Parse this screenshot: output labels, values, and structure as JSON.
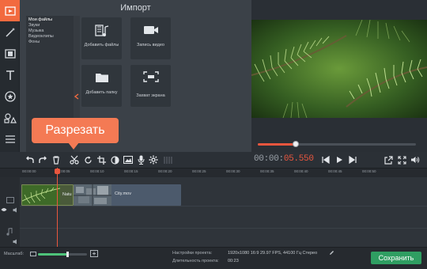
{
  "import": {
    "title": "Импорт",
    "categories": [
      "Мои файлы",
      "Звуки",
      "Музыка",
      "Видеоклипы",
      "Фоны"
    ],
    "buttons": [
      {
        "label": "Добавить файлы",
        "icon": "film-music-icon"
      },
      {
        "label": "Запись видео",
        "icon": "camera-icon"
      },
      {
        "label": "Добавить папку",
        "icon": "folder-icon"
      },
      {
        "label": "Захват экрана",
        "icon": "screen-capture-icon"
      }
    ]
  },
  "tooltip": {
    "text": "Разрезать"
  },
  "player": {
    "timecode_main": "00:00:",
    "timecode_accent": "05.550",
    "progress": 0.24
  },
  "timeline": {
    "ticks": [
      "00:00:00",
      "00:00:05",
      "00:00:10",
      "00:00:15",
      "00:00:20",
      "00:00:25",
      "00:00:30",
      "00:00:35",
      "00:00:40",
      "00:00:45",
      "00:00:50"
    ],
    "clips": [
      {
        "name": "Natu"
      },
      {
        "name": "City.mov"
      }
    ]
  },
  "status": {
    "zoom_label": "Масштаб:",
    "zoom_level": 0.6,
    "settings_label": "Настройки проекта:",
    "settings_value": "1920x1080 16:9 29.97 FPS, 44100 Гц Стерео",
    "duration_label": "Длительность проекта:",
    "duration_value": "00:23",
    "save_label": "Сохранить"
  },
  "colors": {
    "accent": "#f26a3f",
    "save": "#2f9e62",
    "timecode_accent": "#e9563e"
  }
}
